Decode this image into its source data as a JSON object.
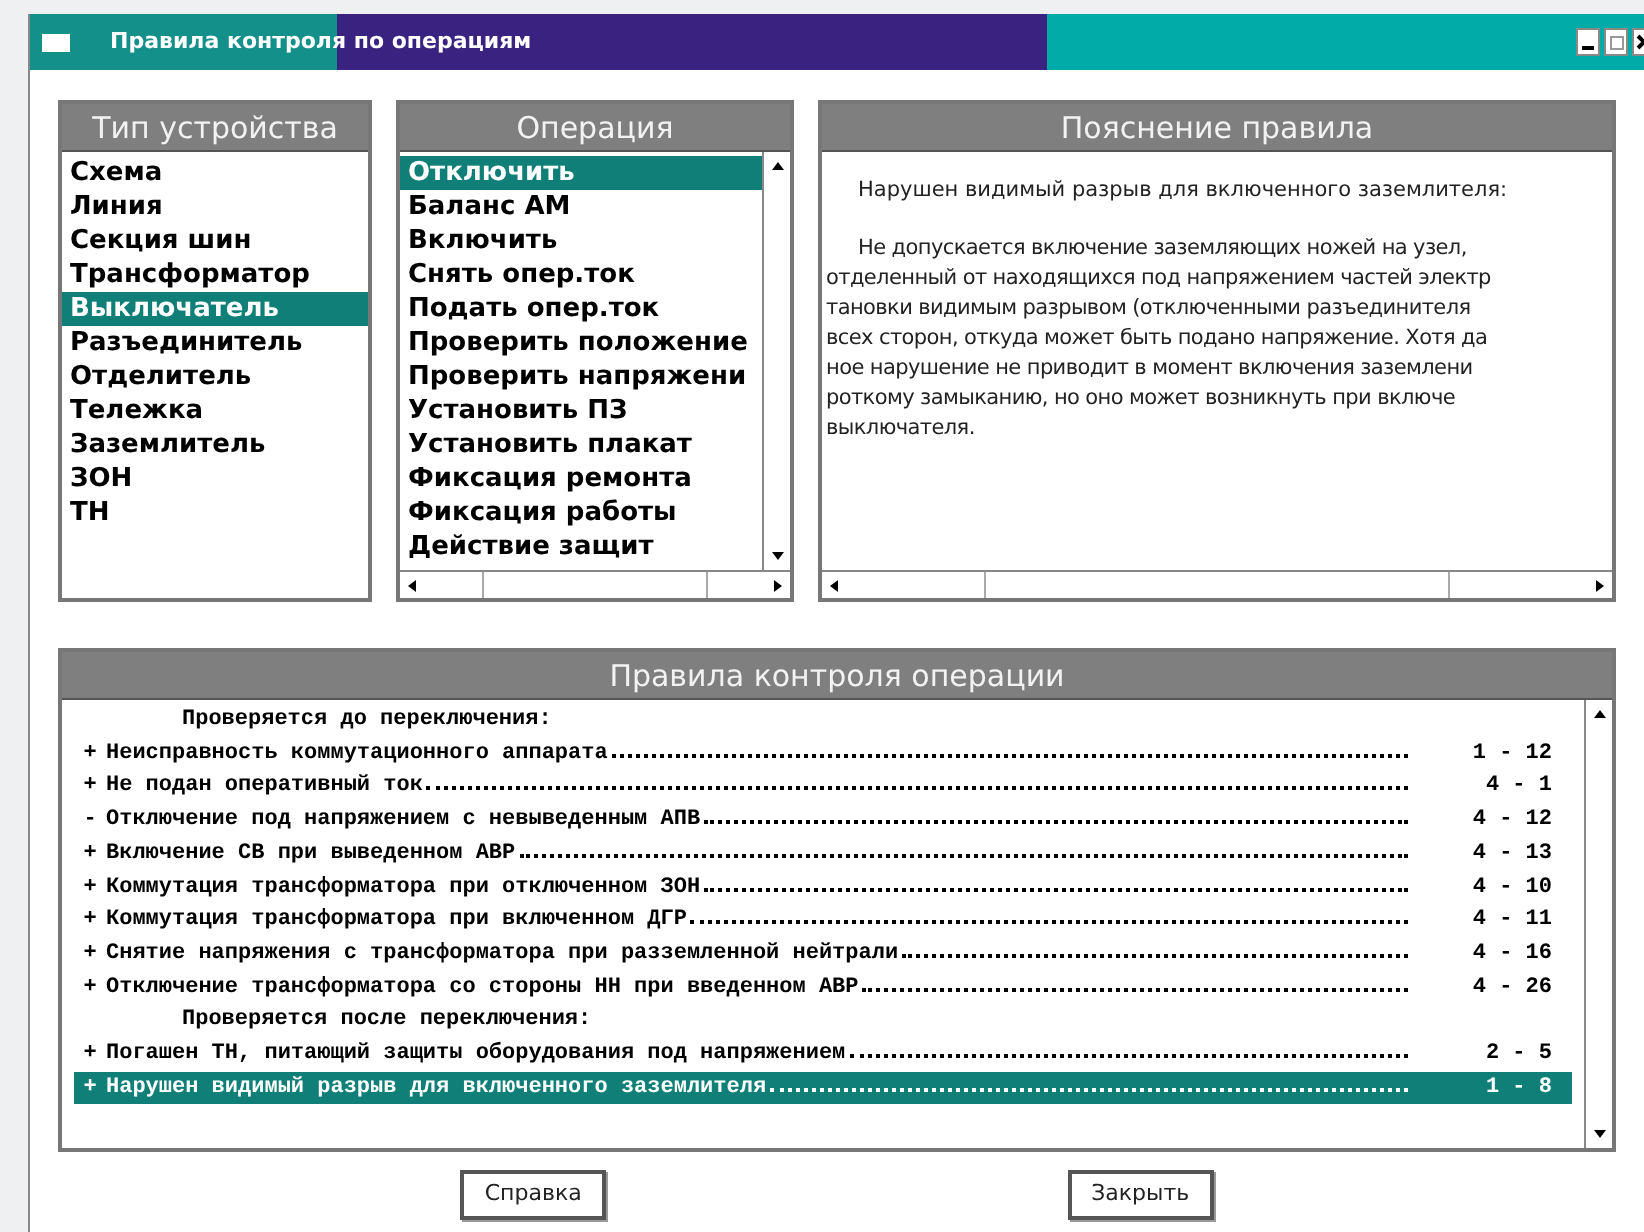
{
  "window": {
    "title": "Правила контроля по операциям"
  },
  "device_types": {
    "title": "Тип устройства",
    "items": [
      {
        "label": "Схема",
        "selected": false
      },
      {
        "label": "Линия",
        "selected": false
      },
      {
        "label": "Секция шин",
        "selected": false
      },
      {
        "label": "Трансформатор",
        "selected": false
      },
      {
        "label": "Выключатель",
        "selected": true
      },
      {
        "label": "Разъединитель",
        "selected": false
      },
      {
        "label": "Отделитель",
        "selected": false
      },
      {
        "label": "Тележка",
        "selected": false
      },
      {
        "label": "Заземлитель",
        "selected": false
      },
      {
        "label": "ЗОН",
        "selected": false
      },
      {
        "label": "ТН",
        "selected": false
      }
    ]
  },
  "operations": {
    "title": "Операция",
    "items": [
      {
        "label": "Отключить",
        "selected": true
      },
      {
        "label": "Баланс АМ",
        "selected": false
      },
      {
        "label": "Включить",
        "selected": false
      },
      {
        "label": "Снять опер.ток",
        "selected": false
      },
      {
        "label": "Подать опер.ток",
        "selected": false
      },
      {
        "label": "Проверить положение",
        "selected": false
      },
      {
        "label": "Проверить напряжени",
        "selected": false
      },
      {
        "label": "Установить ПЗ",
        "selected": false
      },
      {
        "label": "Установить плакат",
        "selected": false
      },
      {
        "label": "Фиксация ремонта",
        "selected": false
      },
      {
        "label": "Фиксация работы",
        "selected": false
      },
      {
        "label": "Действие защит",
        "selected": false
      }
    ]
  },
  "explanation": {
    "title": "Пояснение правила",
    "heading": "Нарушен видимый разрыв для включенного заземлителя:",
    "lines": [
      "Не допускается включение заземляющих ножей на узел,",
      "отделенный от находящихся под напряжением частей электр",
      "тановки видимым разрывом (отключенными разъединителя",
      "всех сторон, откуда может быть подано напряжение. Хотя да",
      "ное нарушение не приводит в момент включения заземлени",
      "роткому замыканию, но оно может возникнуть при включе",
      "выключателя."
    ]
  },
  "rules": {
    "title": "Правила контроля операции",
    "rows": [
      {
        "kind": "header",
        "text": "Проверяется до переключения:"
      },
      {
        "kind": "rule",
        "sign": "+",
        "text": "Неисправность коммутационного аппарата",
        "code": "1 - 12",
        "selected": false
      },
      {
        "kind": "rule",
        "sign": "+",
        "text": "Не подан оперативный ток",
        "code": "4 - 1",
        "selected": false
      },
      {
        "kind": "rule",
        "sign": "-",
        "text": "Отключение под напряжением с невыведенным АПВ",
        "code": "4 - 12",
        "selected": false
      },
      {
        "kind": "rule",
        "sign": "+",
        "text": "Включение СВ при выведенном АВР",
        "code": "4 - 13",
        "selected": false
      },
      {
        "kind": "rule",
        "sign": "+",
        "text": "Коммутация трансформатора при отключенном ЗОН",
        "code": "4 - 10",
        "selected": false
      },
      {
        "kind": "rule",
        "sign": "+",
        "text": "Коммутация трансформатора при включенном ДГР",
        "code": "4 - 11",
        "selected": false
      },
      {
        "kind": "rule",
        "sign": "+",
        "text": "Снятие напряжения с трансформатора при разземленной нейтрали",
        "code": "4 - 16",
        "selected": false
      },
      {
        "kind": "rule",
        "sign": "+",
        "text": "Отключение трансформатора со стороны НН при введенном АВР",
        "code": "4 - 26",
        "selected": false
      },
      {
        "kind": "header",
        "text": "Проверяется после переключения:"
      },
      {
        "kind": "rule",
        "sign": "+",
        "text": "Погашен ТН, питающий защиты оборудования под напряжением",
        "code": "2 - 5",
        "selected": false
      },
      {
        "kind": "rule",
        "sign": "+",
        "text": "Нарушен видимый разрыв для включенного заземлителя",
        "code": "1 - 8",
        "selected": true
      }
    ]
  },
  "buttons": [
    "Справка",
    "Закрыть"
  ]
}
